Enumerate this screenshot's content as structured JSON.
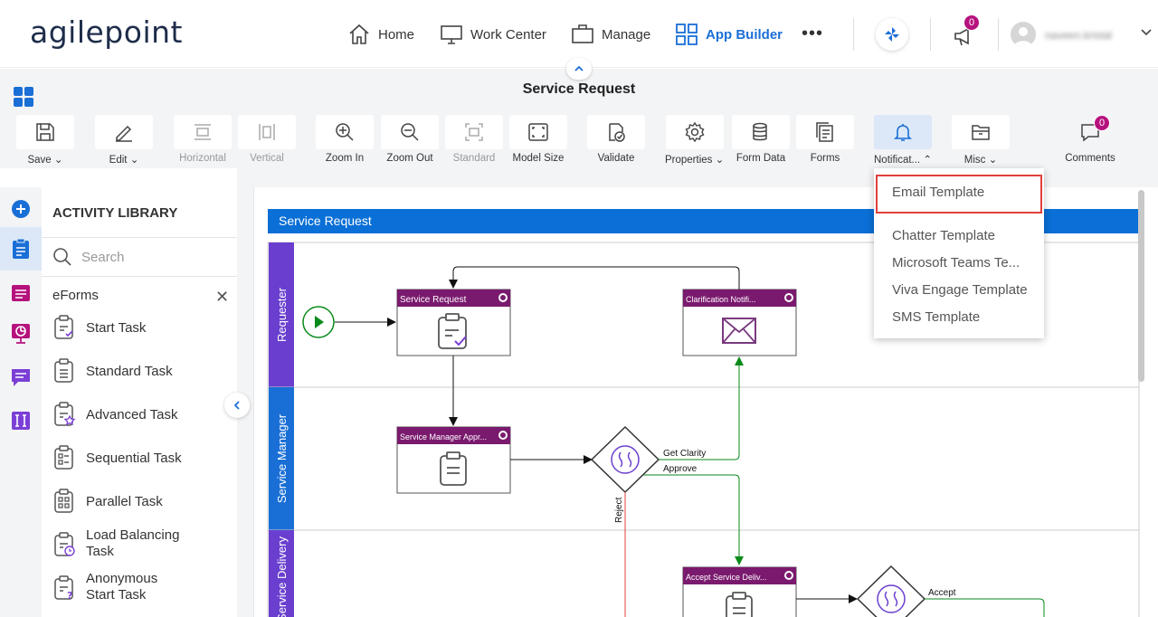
{
  "app": {
    "logo": "agilepoint",
    "page_title": "Service Request"
  },
  "nav": {
    "home": "Home",
    "work_center": "Work Center",
    "manage": "Manage",
    "app_builder": "App Builder",
    "more": "•••",
    "notifications_count": "0",
    "user_name": "naveen.kristal"
  },
  "toolbar": {
    "save": "Save",
    "edit": "Edit",
    "horizontal": "Horizontal",
    "vertical": "Vertical",
    "zoom_in": "Zoom In",
    "zoom_out": "Zoom Out",
    "standard": "Standard",
    "model_size": "Model Size",
    "validate": "Validate",
    "properties": "Properties",
    "form_data": "Form Data",
    "forms": "Forms",
    "notifications": "Notificat...",
    "misc": "Misc",
    "comments": "Comments",
    "comments_count": "0"
  },
  "notifications_menu": {
    "items": [
      "Email Template",
      "Chatter Template",
      "Microsoft Teams Te...",
      "Viva Engage Template",
      "SMS Template"
    ]
  },
  "library": {
    "title": "ACTIVITY LIBRARY",
    "search_placeholder": "Search",
    "category": "eForms",
    "items": [
      {
        "label": "Start Task"
      },
      {
        "label": "Standard Task"
      },
      {
        "label": "Advanced Task"
      },
      {
        "label": "Sequential Task"
      },
      {
        "label": "Parallel Task"
      },
      {
        "label": "Load Balancing Task"
      },
      {
        "label": "Anonymous Start Task"
      }
    ]
  },
  "diagram": {
    "pool": "Service Request",
    "lanes": [
      "Requester",
      "Service Manager",
      "Service Delivery"
    ],
    "tasks": {
      "service_request": "Service Request",
      "clarification": "Clarification Notifi...",
      "manager_approval": "Service Manager Appr...",
      "accept_delivery": "Accept Service Deliv..."
    },
    "flows": {
      "get_clarity": "Get Clarity",
      "approve": "Approve",
      "reject": "Reject",
      "accept": "Accept"
    }
  },
  "colors": {
    "accent": "#1a6fd6",
    "task_header": "#7a1a6e",
    "lane": "#6a3fcf",
    "lane_blue": "#1a6fd6",
    "pool_header": "#0a6fd6",
    "badge": "#b6127e"
  }
}
